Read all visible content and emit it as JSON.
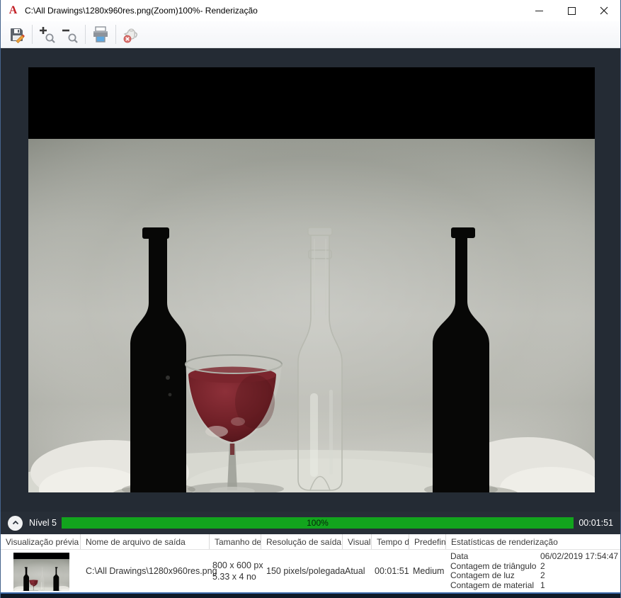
{
  "window": {
    "title": "C:\\All Drawings\\1280x960res.png(Zoom)100%- Renderização",
    "app_glyph": "A"
  },
  "toolbar": {
    "buttons": [
      {
        "name": "save-render",
        "icon": "save-icon"
      },
      {
        "name": "zoom-in",
        "icon": "zoom-in-icon"
      },
      {
        "name": "zoom-out",
        "icon": "zoom-out-icon"
      },
      {
        "name": "print",
        "icon": "print-icon"
      },
      {
        "name": "cancel-render",
        "icon": "teapot-cancel-icon",
        "disabled": true
      }
    ]
  },
  "progress": {
    "level_label": "Nível 5",
    "percent_label": "100%",
    "percent_value": 100,
    "elapsed": "00:01:51",
    "bar_color": "#12a41d"
  },
  "table": {
    "headers": [
      "Visualização prévia",
      "Nome de arquivo de saída",
      "Tamanho de",
      "Resolução de saída",
      "Visual",
      "Tempo d",
      "Predefini",
      "Estatísticas de renderização"
    ],
    "row": {
      "filename": "C:\\All Drawings\\1280x960res.png",
      "size_px": "800 x 600 px",
      "size_units": "5.33 x 4 no",
      "resolution": "150 pixels/polegada",
      "visual": "Atual",
      "render_time": "00:01:51",
      "preset": "Medium",
      "stats": [
        {
          "label": "Data",
          "value": "06/02/2019 17:54:47"
        },
        {
          "label": "Contagem de triângulo",
          "value": "2"
        },
        {
          "label": "Contagem de luz",
          "value": "2"
        },
        {
          "label": "Contagem de material",
          "value": "1"
        }
      ]
    }
  }
}
